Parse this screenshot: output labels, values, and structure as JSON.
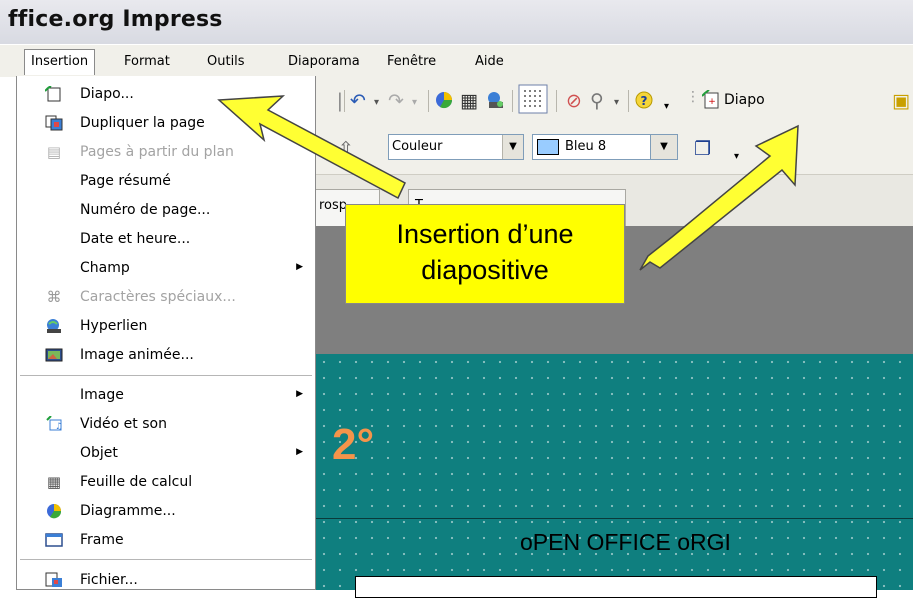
{
  "window": {
    "title": "ffice.org Impress"
  },
  "menubar": {
    "items": [
      "Insertion",
      "Format",
      "Outils",
      "Diaporama",
      "Fenêtre",
      "Aide"
    ]
  },
  "toolbar": {
    "diapo_label": "Diapo",
    "fill_type": "Couleur",
    "fill_color": "Bleu 8",
    "fill_swatch": "#99ccff"
  },
  "tabs": [
    "rosp",
    "T"
  ],
  "slide": {
    "number_text": "2°",
    "title_text": "oPEN OFFICE oRGI",
    "background": "#0f7f7f",
    "number_color": "#f5944a"
  },
  "menu": {
    "items": [
      {
        "label": "Diapo...",
        "icon": "new-slide-icon",
        "disabled": false,
        "submenu": false
      },
      {
        "label": "Dupliquer la page",
        "icon": "duplicate-page-icon",
        "disabled": false,
        "submenu": false
      },
      {
        "label": "Pages à partir du plan",
        "icon": "pages-from-outline-icon",
        "disabled": true,
        "submenu": false
      },
      {
        "label": "Page résumé",
        "icon": "",
        "disabled": false,
        "submenu": false
      },
      {
        "label": "Numéro de page...",
        "icon": "",
        "disabled": false,
        "submenu": false
      },
      {
        "label": "Date et heure...",
        "icon": "",
        "disabled": false,
        "submenu": false
      },
      {
        "label": "Champ",
        "icon": "",
        "disabled": false,
        "submenu": true
      },
      {
        "label": "Caractères spéciaux...",
        "icon": "special-characters-icon",
        "disabled": true,
        "submenu": false
      },
      {
        "label": "Hyperlien",
        "icon": "hyperlink-icon",
        "disabled": false,
        "submenu": false
      },
      {
        "label": "Image animée...",
        "icon": "animated-image-icon",
        "disabled": false,
        "submenu": false
      },
      {
        "label": "Image",
        "icon": "",
        "disabled": false,
        "submenu": true
      },
      {
        "label": "Vidéo et son",
        "icon": "video-sound-icon",
        "disabled": false,
        "submenu": false
      },
      {
        "label": "Objet",
        "icon": "",
        "disabled": false,
        "submenu": true
      },
      {
        "label": "Feuille de calcul",
        "icon": "spreadsheet-icon",
        "disabled": false,
        "submenu": false
      },
      {
        "label": "Diagramme...",
        "icon": "chart-icon",
        "disabled": false,
        "submenu": false
      },
      {
        "label": "Frame",
        "icon": "frame-icon",
        "disabled": false,
        "submenu": false
      },
      {
        "label": "Fichier...",
        "icon": "file-icon",
        "disabled": false,
        "submenu": false
      }
    ]
  },
  "callout": {
    "line1": "Insertion d’une",
    "line2": "diapositive",
    "color": "#ffff00"
  },
  "colors": {
    "arrow_fill": "#ffff33",
    "menu_highlight": "#ffffff"
  }
}
